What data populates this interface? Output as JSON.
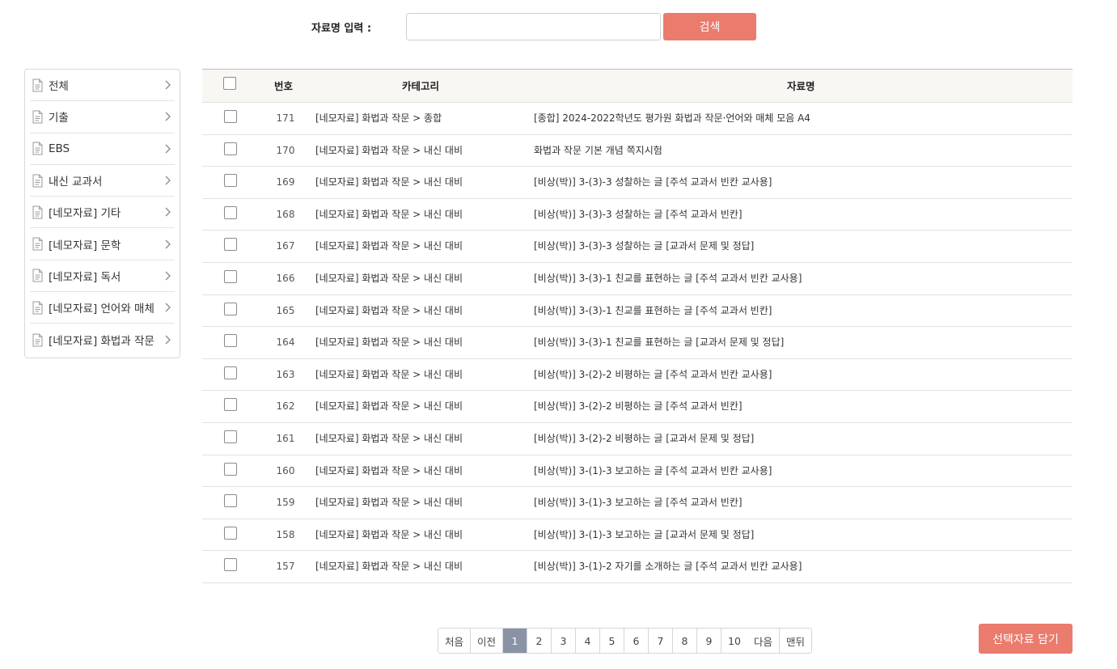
{
  "search": {
    "label": "자료명 입력 :",
    "value": "",
    "placeholder": "",
    "button_label": "검색"
  },
  "sidebar": {
    "items": [
      {
        "label": "전체",
        "icon": "document-icon"
      },
      {
        "label": "기출",
        "icon": "document-icon"
      },
      {
        "label": "EBS",
        "icon": "document-icon"
      },
      {
        "label": "내신 교과서",
        "icon": "document-icon"
      },
      {
        "label": "[네모자료] 기타",
        "icon": "document-icon"
      },
      {
        "label": "[네모자료] 문학",
        "icon": "document-icon"
      },
      {
        "label": "[네모자료] 독서",
        "icon": "document-icon"
      },
      {
        "label": "[네모자료] 언어와 매체",
        "icon": "document-icon"
      },
      {
        "label": "[네모자료] 화법과 작문",
        "icon": "document-icon"
      }
    ]
  },
  "table": {
    "headers": {
      "number": "번호",
      "category": "카테고리",
      "name": "자료명"
    },
    "rows": [
      {
        "number": "171",
        "category": "[네모자료] 화법과 작문 > 종합",
        "name": "[종합] 2024-2022학년도 평가원 화법과 작문·언어와 매체 모음 A4"
      },
      {
        "number": "170",
        "category": "[네모자료] 화법과 작문 > 내신 대비",
        "name": "화법과 작문 기본 개념 쪽지시험"
      },
      {
        "number": "169",
        "category": "[네모자료] 화법과 작문 > 내신 대비",
        "name": "[비상(박)] 3-(3)-3 성찰하는 글 [주석 교과서 빈칸 교사용]"
      },
      {
        "number": "168",
        "category": "[네모자료] 화법과 작문 > 내신 대비",
        "name": "[비상(박)] 3-(3)-3 성찰하는 글 [주석 교과서 빈칸]"
      },
      {
        "number": "167",
        "category": "[네모자료] 화법과 작문 > 내신 대비",
        "name": "[비상(박)] 3-(3)-3 성찰하는 글 [교과서 문제 및 정답]"
      },
      {
        "number": "166",
        "category": "[네모자료] 화법과 작문 > 내신 대비",
        "name": "[비상(박)] 3-(3)-1 친교를 표현하는 글 [주석 교과서 빈칸 교사용]"
      },
      {
        "number": "165",
        "category": "[네모자료] 화법과 작문 > 내신 대비",
        "name": "[비상(박)] 3-(3)-1 친교를 표현하는 글 [주석 교과서 빈칸]"
      },
      {
        "number": "164",
        "category": "[네모자료] 화법과 작문 > 내신 대비",
        "name": "[비상(박)] 3-(3)-1 친교를 표현하는 글 [교과서 문제 및 정답]"
      },
      {
        "number": "163",
        "category": "[네모자료] 화법과 작문 > 내신 대비",
        "name": "[비상(박)] 3-(2)-2 비평하는 글 [주석 교과서 빈칸 교사용]"
      },
      {
        "number": "162",
        "category": "[네모자료] 화법과 작문 > 내신 대비",
        "name": "[비상(박)] 3-(2)-2 비평하는 글 [주석 교과서 빈칸]"
      },
      {
        "number": "161",
        "category": "[네모자료] 화법과 작문 > 내신 대비",
        "name": "[비상(박)] 3-(2)-2 비평하는 글 [교과서 문제 및 정답]"
      },
      {
        "number": "160",
        "category": "[네모자료] 화법과 작문 > 내신 대비",
        "name": "[비상(박)] 3-(1)-3 보고하는 글 [주석 교과서 빈칸 교사용]"
      },
      {
        "number": "159",
        "category": "[네모자료] 화법과 작문 > 내신 대비",
        "name": "[비상(박)] 3-(1)-3 보고하는 글 [주석 교과서 빈칸]"
      },
      {
        "number": "158",
        "category": "[네모자료] 화법과 작문 > 내신 대비",
        "name": "[비상(박)] 3-(1)-3 보고하는 글 [교과서 문제 및 정답]"
      },
      {
        "number": "157",
        "category": "[네모자료] 화법과 작문 > 내신 대비",
        "name": "[비상(박)] 3-(1)-2 자기를 소개하는 글 [주석 교과서 빈칸 교사용]"
      }
    ]
  },
  "pagination": {
    "first": "처음",
    "prev": "이전",
    "pages": [
      "1",
      "2",
      "3",
      "4",
      "5",
      "6",
      "7",
      "8",
      "9",
      "10"
    ],
    "current": "1",
    "next": "다음",
    "last": "맨뒤"
  },
  "actions": {
    "add_selected_label": "선택자료 담기"
  },
  "colors": {
    "accent": "#ea7b6d",
    "active_page": "#8a93a6",
    "header_bg": "#f9f7f3"
  }
}
